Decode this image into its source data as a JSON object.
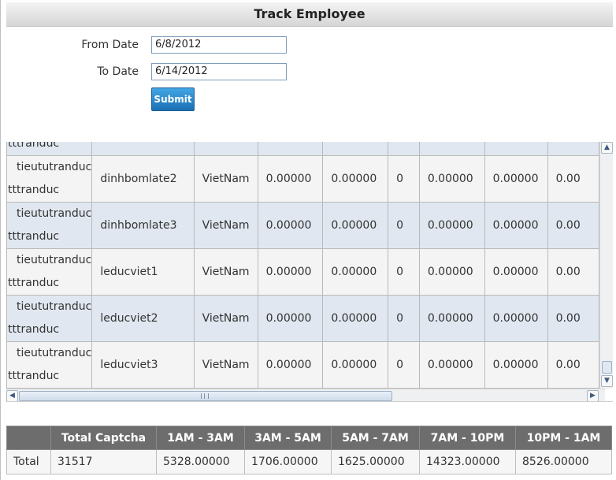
{
  "header": {
    "title": "Track Employee"
  },
  "form": {
    "from_label": "From Date",
    "from_value": "6/8/2012",
    "to_label": "To Date",
    "to_value": "6/14/2012",
    "submit_label": "Submit"
  },
  "grid": {
    "partial_top_user": "tttranduc",
    "rows": [
      {
        "user_line1": "tieututranduc",
        "user_line2": "tttranduc",
        "name": "dinhbomlate2",
        "country": "VietNam",
        "v1": "0.00000",
        "v2": "0.00000",
        "v3": "0",
        "v4": "0.00000",
        "v5": "0.00000",
        "v6": "0.00"
      },
      {
        "user_line1": "tieututranduc",
        "user_line2": "tttranduc",
        "name": "dinhbomlate3",
        "country": "VietNam",
        "v1": "0.00000",
        "v2": "0.00000",
        "v3": "0",
        "v4": "0.00000",
        "v5": "0.00000",
        "v6": "0.00"
      },
      {
        "user_line1": "tieututranduc",
        "user_line2": "tttranduc",
        "name": "leducviet1",
        "country": "VietNam",
        "v1": "0.00000",
        "v2": "0.00000",
        "v3": "0",
        "v4": "0.00000",
        "v5": "0.00000",
        "v6": "0.00"
      },
      {
        "user_line1": "tieututranduc",
        "user_line2": "tttranduc",
        "name": "leducviet2",
        "country": "VietNam",
        "v1": "0.00000",
        "v2": "0.00000",
        "v3": "0",
        "v4": "0.00000",
        "v5": "0.00000",
        "v6": "0.00"
      },
      {
        "user_line1": "tieututranduc",
        "user_line2": "tttranduc",
        "name": "leducviet3",
        "country": "VietNam",
        "v1": "0.00000",
        "v2": "0.00000",
        "v3": "0",
        "v4": "0.00000",
        "v5": "0.00000",
        "v6": "0.00"
      }
    ]
  },
  "summary": {
    "headers": [
      "",
      "Total Captcha",
      "1AM - 3AM",
      "3AM - 5AM",
      "5AM - 7AM",
      "7AM - 10PM",
      "10PM - 1AM"
    ],
    "row": [
      "Total",
      "31517",
      "5328.00000",
      "1706.00000",
      "1625.00000",
      "14323.00000",
      "8526.00000"
    ]
  },
  "icons": {
    "scroll_up": "▲",
    "scroll_down": "▼",
    "scroll_left": "◀",
    "scroll_right": "▶"
  },
  "colors": {
    "row_alt": "#e0e7f0",
    "row_normal": "#f4f4f4",
    "summary_header": "#6d6d6d",
    "submit_button": "#1a6fb3"
  }
}
